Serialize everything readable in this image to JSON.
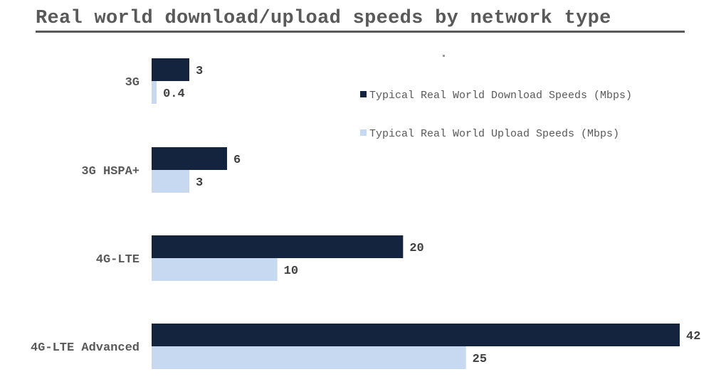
{
  "chart_data": {
    "type": "bar",
    "orientation": "horizontal",
    "title": "Real world download/upload speeds by network type",
    "categories": [
      "3G",
      "3G HSPA+",
      "4G-LTE",
      "4G-LTE Advanced"
    ],
    "series": [
      {
        "name": "Typical Real World Download Speeds (Mbps)",
        "color": "#14243f",
        "values": [
          3,
          6,
          20,
          42
        ],
        "labels": [
          "3",
          "6",
          "20",
          "42"
        ]
      },
      {
        "name": "Typical Real World Upload Speeds (Mbps)",
        "color": "#c6d9f0",
        "values": [
          0.4,
          3,
          10,
          25
        ],
        "labels": [
          "0.4",
          "3",
          "10",
          "25"
        ]
      }
    ],
    "xlabel": "",
    "ylabel": "",
    "xlim": [
      0,
      42
    ],
    "grid": false,
    "legend_position": "top-right"
  }
}
